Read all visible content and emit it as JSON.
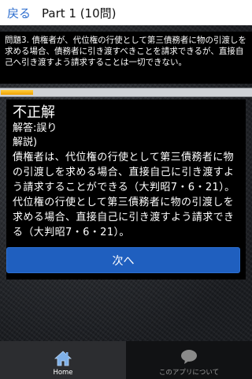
{
  "header": {
    "back_label": "戻る",
    "title": "Part 1 (10問)"
  },
  "question": {
    "text": "問題3. 債権者が、代位権の行使として第三債務者に物の引渡しを求める場合、債務者に引き渡すべきことを請求できるが、直接自己へ引き渡すよう請求することは一切できない。"
  },
  "progress": {
    "value": 0.13
  },
  "answer": {
    "verdict": "不正解",
    "answer_line": "解答:誤り",
    "explain_label": "解説)",
    "explanation": "債権者は、代位権の行使として第三債務者に物の引渡しを求める場合、直接自己に引き渡すよう請求することができる（大判昭7・6・21）。代位権の行使として第三債務者に物の引渡しを求める場合、直接自己に引き渡すよう請求できる（大判昭7・6・21）。"
  },
  "next_button": {
    "label": "次へ"
  },
  "bottom_nav": {
    "items": [
      {
        "label": "Home",
        "icon": "home-icon",
        "active": true
      },
      {
        "label": "このアプリについて",
        "icon": "speech-bubble-icon",
        "active": false
      }
    ]
  },
  "colors": {
    "link_blue": "#2f6fcf",
    "button_blue": "#1f5fbf",
    "progress_orange": "#f0a000"
  }
}
